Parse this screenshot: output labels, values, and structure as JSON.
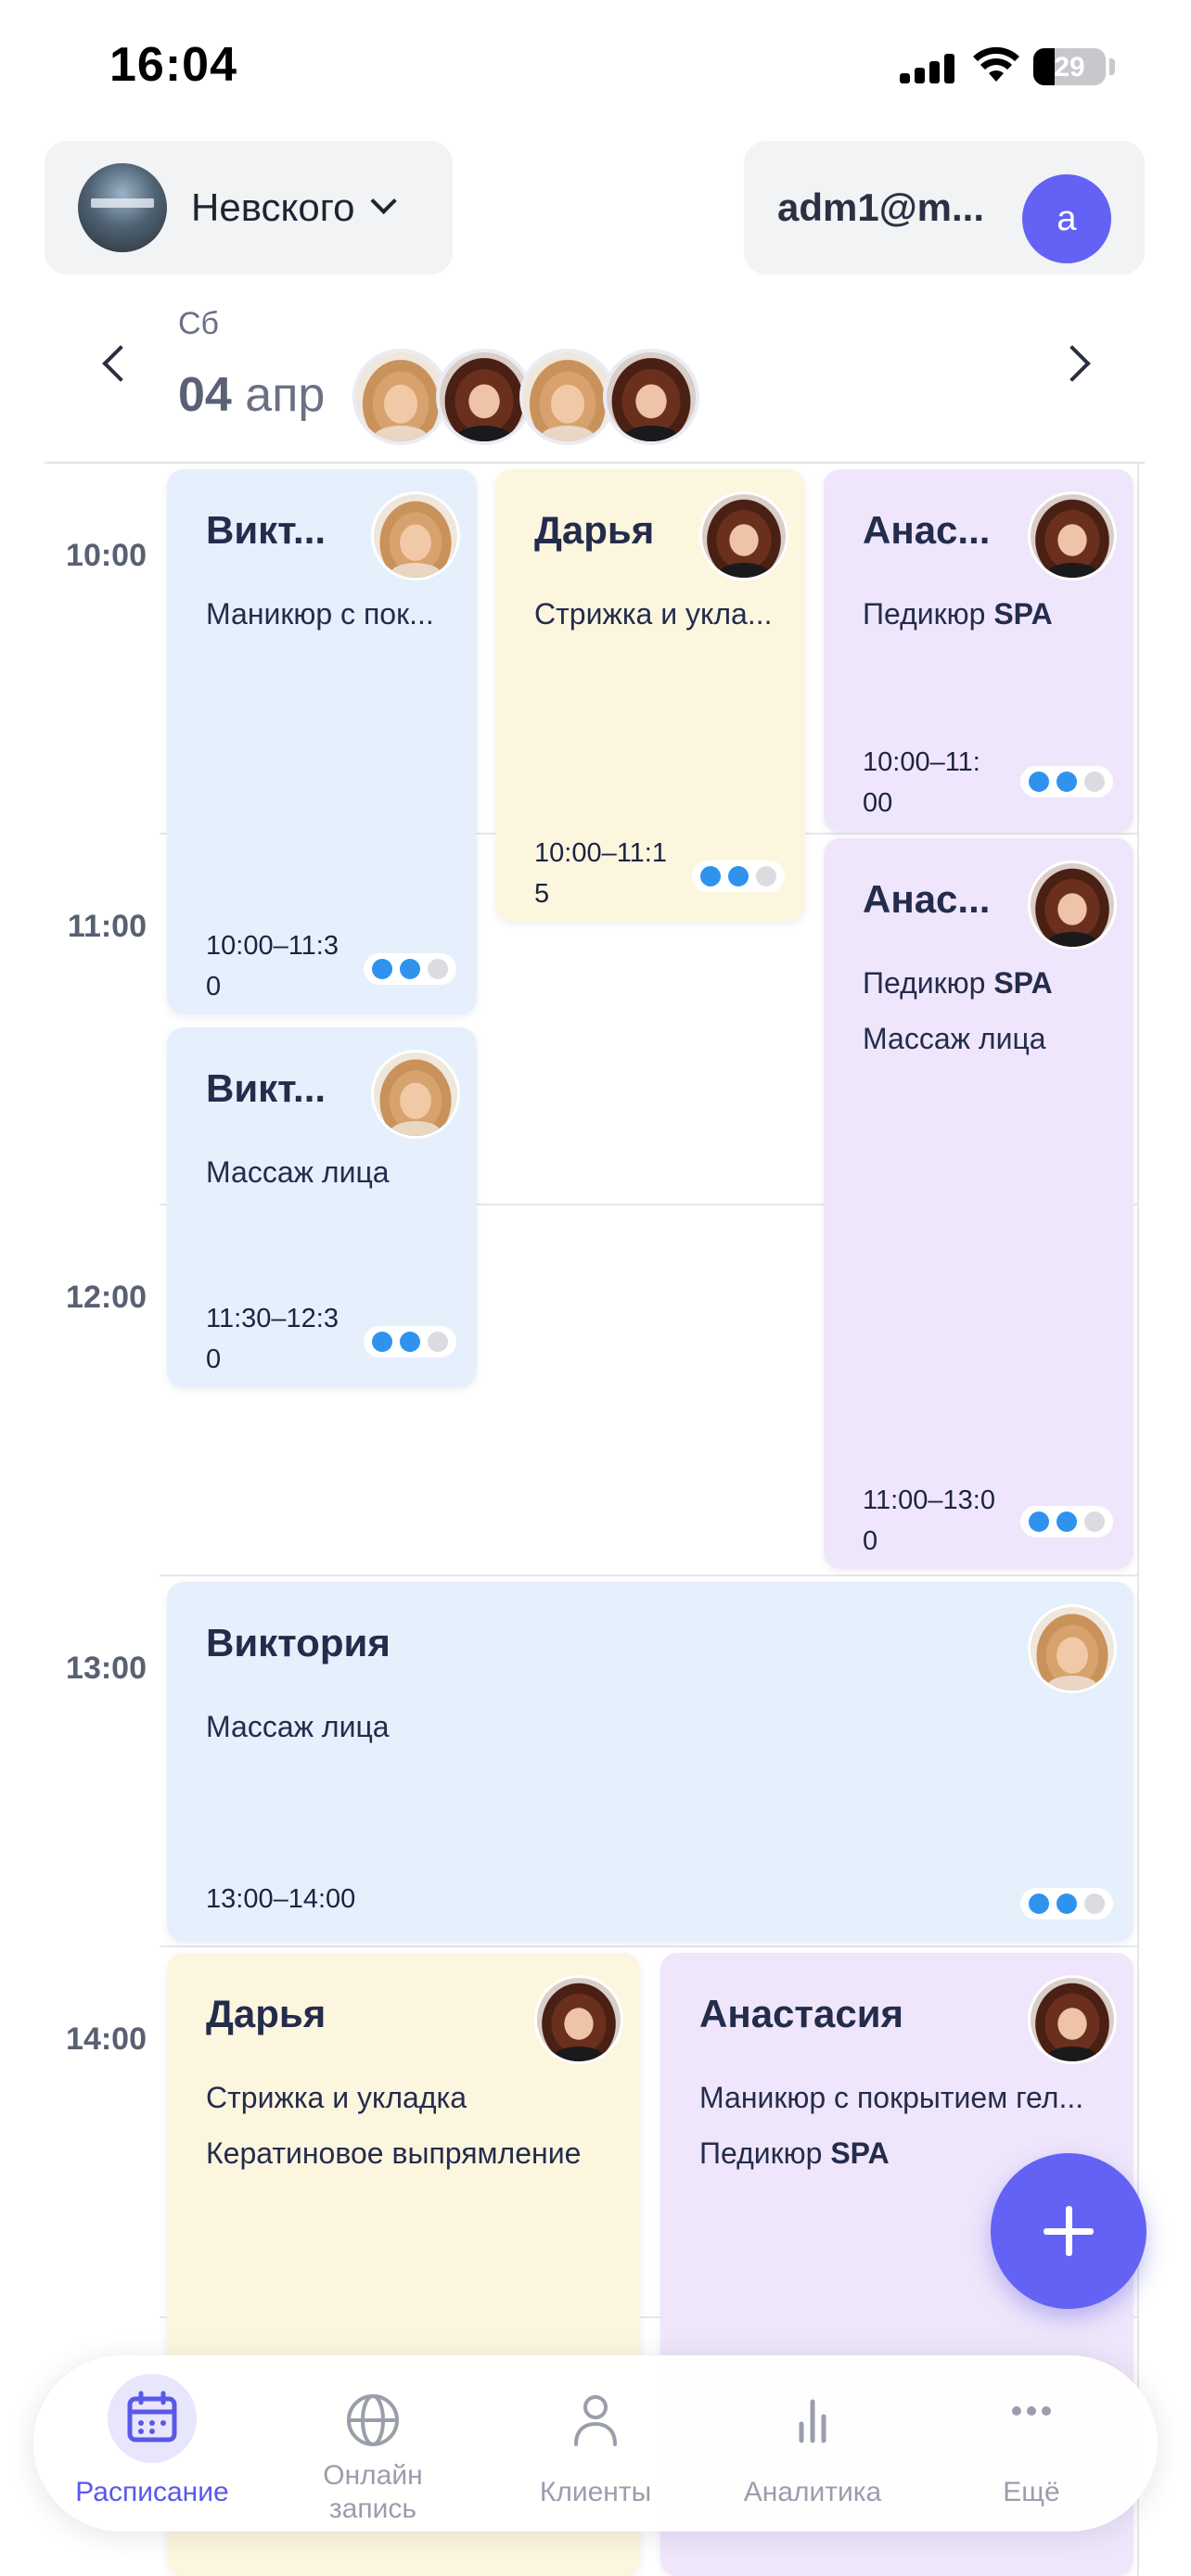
{
  "status_bar": {
    "time": "16:04",
    "battery": "29"
  },
  "header": {
    "branch_name": "Невского",
    "account_email": "adm1@m...",
    "account_initial": "a"
  },
  "date_nav": {
    "day_of_week": "Сб",
    "date_day": "04",
    "date_month": "апр"
  },
  "time_labels": [
    "10:00",
    "11:00",
    "12:00",
    "13:00",
    "14:00"
  ],
  "appointments": [
    {
      "name": "Викт...",
      "services": [
        "Маникюр с пок..."
      ],
      "time": "10:00–11:30",
      "status_done": 2,
      "status_total": 3
    },
    {
      "name": "Дарья",
      "services": [
        "Стрижка и укла..."
      ],
      "time": "10:00–11:15",
      "status_done": 2,
      "status_total": 3
    },
    {
      "name": "Анас...",
      "services": [
        "Педикюр SPA"
      ],
      "time": "10:00–11:00",
      "status_done": 2,
      "status_total": 3
    },
    {
      "name": "Анас...",
      "services": [
        "Педикюр SPA",
        "Массаж лица"
      ],
      "time": "11:00–13:00",
      "status_done": 2,
      "status_total": 3
    },
    {
      "name": "Викт...",
      "services": [
        "Массаж лица"
      ],
      "time": "11:30–12:30",
      "status_done": 2,
      "status_total": 3
    },
    {
      "name": "Виктория",
      "services": [
        "Массаж лица"
      ],
      "time": "13:00–14:00",
      "status_done": 2,
      "status_total": 3
    },
    {
      "name": "Дарья",
      "services": [
        "Стрижка и укладка",
        "Кератиновое выпрямление"
      ],
      "time": "",
      "status_done": 0,
      "status_total": 0
    },
    {
      "name": "Анастасия",
      "services": [
        "Маникюр с покрытием гел...",
        "Педикюр SPA"
      ],
      "time": "",
      "status_done": 0,
      "status_total": 0
    }
  ],
  "tab_bar": {
    "tabs": [
      {
        "label": "Расписание",
        "icon": "calendar-icon",
        "active": true
      },
      {
        "label": "Онлайн запись",
        "icon": "globe-icon",
        "active": false
      },
      {
        "label": "Клиенты",
        "icon": "person-icon",
        "active": false
      },
      {
        "label": "Аналитика",
        "icon": "bar-chart-icon",
        "active": false
      },
      {
        "label": "Ещё",
        "icon": "more-icon",
        "active": false
      }
    ]
  },
  "colors": {
    "accent": "#6462f5",
    "card_blue": "#e6effc",
    "card_yellow": "#fdf6df",
    "card_purple": "#efe6fb",
    "status_dot": "#2f93ee"
  }
}
